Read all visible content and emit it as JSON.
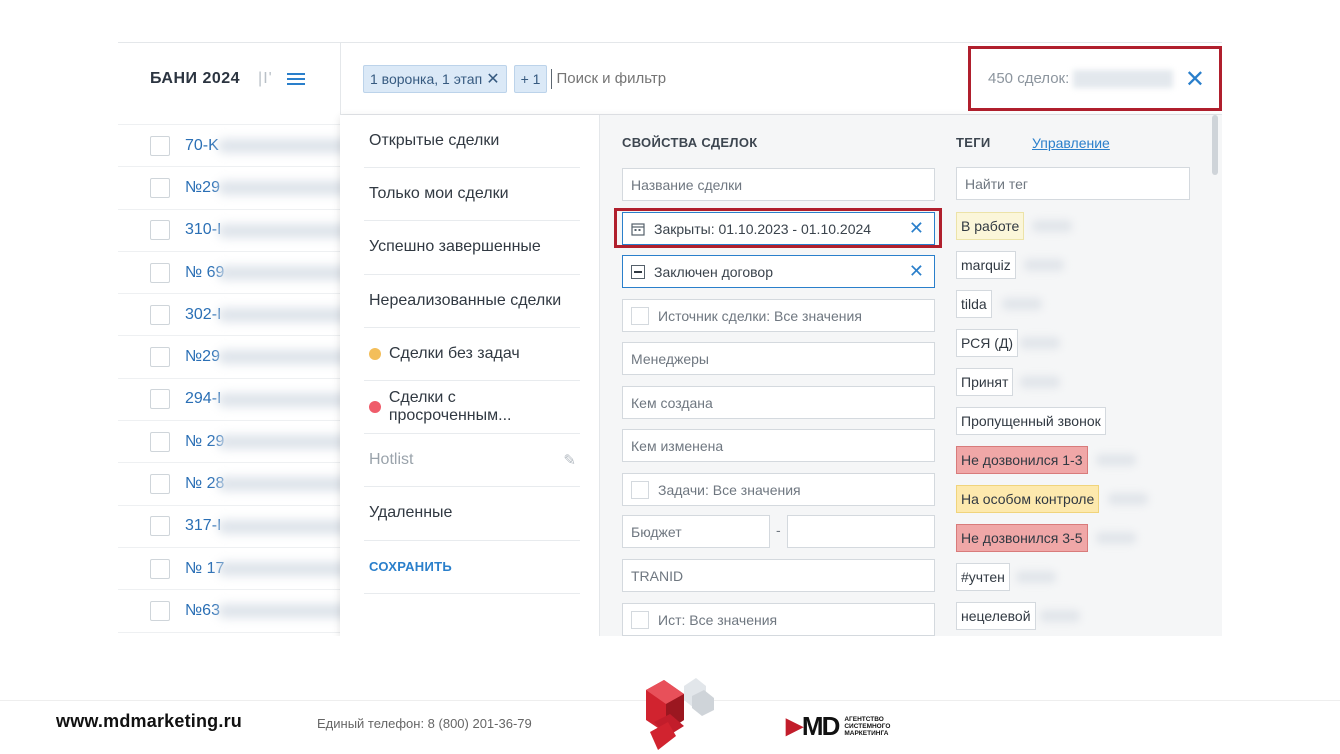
{
  "header": {
    "pipeline_title": "БАНИ 2024",
    "view_toggle": "|I'",
    "filter_chip": "1 воронка, 1 этап",
    "extra_chip": "+ 1",
    "search_placeholder": "Поиск и фильтр",
    "deal_count_label": "450 сделок:"
  },
  "deals_list": [
    {
      "num": "70-K"
    },
    {
      "num": "№29"
    },
    {
      "num": "310-I"
    },
    {
      "num": "№ 69"
    },
    {
      "num": "302-I"
    },
    {
      "num": "№29"
    },
    {
      "num": "294-I"
    },
    {
      "num": "№ 29"
    },
    {
      "num": "№ 28"
    },
    {
      "num": "317-I"
    },
    {
      "num": "№ 17"
    },
    {
      "num": "№63"
    }
  ],
  "presets": {
    "items": [
      {
        "label": "Открытые сделки"
      },
      {
        "label": "Только мои сделки"
      },
      {
        "label": "Успешно завершенные"
      },
      {
        "label": "Нереализованные сделки"
      },
      {
        "label": "Сделки без задач",
        "dot_color": "#f3be5a"
      },
      {
        "label": "Сделки с просроченным...",
        "dot_color": "#ef5c6a"
      },
      {
        "label": "Hotlist"
      },
      {
        "label": "Удаленные"
      }
    ],
    "save_label": "СОХРАНИТЬ"
  },
  "properties": {
    "section_title": "СВОЙСТВА СДЕЛОК",
    "deal_name_placeholder": "Название сделки",
    "closed_range": "Закрыты: 01.10.2023 - 01.10.2024",
    "contract_status": "Заключен договор",
    "source": "Источник сделки: Все значения",
    "managers": "Менеджеры",
    "created_by": "Кем создана",
    "modified_by": "Кем изменена",
    "tasks": "Задачи: Все значения",
    "budget": "Бюджет",
    "budget_dash": "-",
    "tranid": "TRANID",
    "ist": "Ист: Все значения"
  },
  "tags": {
    "section_title": "ТЕГИ",
    "manage_link": "Управление",
    "search_placeholder": "Найти тег",
    "items": [
      {
        "label": "В работе",
        "style": "yellow"
      },
      {
        "label": "marquiz",
        "style": "plain"
      },
      {
        "label": "tilda",
        "style": "plain"
      },
      {
        "label": "РСЯ (Д)",
        "style": "plain"
      },
      {
        "label": "Принят",
        "style": "plain"
      },
      {
        "label": "Пропущенный звонок",
        "style": "plain"
      },
      {
        "label": "Не дозвонился 1-3",
        "style": "red"
      },
      {
        "label": "На особом контроле",
        "style": "amber"
      },
      {
        "label": "Не дозвонился 3-5",
        "style": "red"
      },
      {
        "label": "#учтен",
        "style": "plain"
      },
      {
        "label": "нецелевой",
        "style": "plain"
      }
    ]
  },
  "footer": {
    "website": "www.mdmarketing.ru",
    "phone": "Единый телефон: 8 (800) 201-36-79",
    "logo_text": "MD",
    "logo_sub": "АГЕНТСТВО СИСТЕМНОГО МАРКЕТИНГА"
  },
  "colors": {
    "accent": "#2a7fcb",
    "highlight_border": "#b01f2d"
  }
}
